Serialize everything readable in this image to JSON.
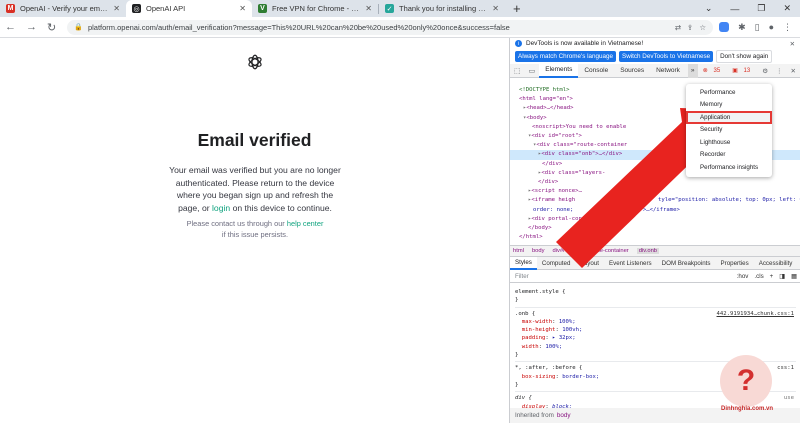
{
  "browser": {
    "tabs": [
      {
        "label": "OpenAI - Verify your email - kha",
        "favicon": "gmail-icon",
        "color": "#d93025",
        "active": false
      },
      {
        "label": "OpenAI API",
        "favicon": "openai-icon",
        "color": "#202123",
        "active": true
      },
      {
        "label": "Free VPN for Chrome - VPN Proxy",
        "favicon": "vpn-icon",
        "color": "#2e7d32",
        "active": false
      },
      {
        "label": "Thank you for installing VeePN",
        "favicon": "veepn-icon",
        "color": "#26a69a",
        "active": false
      }
    ],
    "new_tab": "+",
    "url": "platform.openai.com/auth/email_verification?message=This%20URL%20can%20be%20used%20only%20once&success=false"
  },
  "page": {
    "title": "Email verified",
    "desc_1": "Your email was verified but you are no longer authenticated. Please return to the device where you began sign up and refresh the page, or",
    "desc_link": "login",
    "desc_2": "on this device to continue.",
    "help_1": "Please contact us through our",
    "help_link": "help center",
    "help_2": "if this issue persists."
  },
  "devtools": {
    "info": "DevTools is now available in Vietnamese!",
    "btn_match": "Always match Chrome's language",
    "btn_switch": "Switch DevTools to Vietnamese",
    "btn_dismiss": "Don't show again",
    "tabs": [
      "Elements",
      "Console",
      "Sources",
      "Network"
    ],
    "more": "»",
    "errors": "35",
    "warnings": "13",
    "dom": [
      "<!DOCTYPE html>",
      "<html lang=\"en\">",
      "<head>…</head>",
      "<body>",
      "<noscript>You need to enable",
      "<div id=\"root\">",
      "<div class=\"route-container",
      "<div class=\"onb\">…</div>",
      "</div>",
      "<div class=\"layers-",
      "</div>",
      "<script nonce>…",
      "<iframe heigh",
      "order: none;",
      "<div portal-conta",
      "</body>",
      "</html>"
    ],
    "iframe_style": "tyle=\"position: absolute; top: 0px; left: 0px;",
    "iframe_end": "den;\">…</iframe>",
    "breadcrumbs": [
      "html",
      "body",
      "div#root",
      "div.route-container",
      "div.onb"
    ],
    "style_tabs": [
      "Styles",
      "Computed",
      "Layout",
      "Event Listeners",
      "DOM Breakpoints",
      "Properties",
      "Accessibility"
    ],
    "filter_placeholder": "Filter",
    "filter_hov": ":hov",
    "filter_cls": ".cls",
    "element_style": "element.style {",
    "onb_selector": ".onb {",
    "onb_source": "442.9191934…chunk.css:1",
    "onb_props": [
      {
        "name": "max-width",
        "value": "100%;"
      },
      {
        "name": "min-height",
        "value": "100vh;"
      },
      {
        "name": "padding",
        "value": "▸ 32px;"
      },
      {
        "name": "width",
        "value": "100%;"
      }
    ],
    "universal_selector": "*, :after, :before {",
    "universal_source": "main",
    "universal_source_2": "css:1",
    "universal_prop": {
      "name": "box-sizing",
      "value": "border-box;"
    },
    "div_selector": "div {",
    "div_source": "use",
    "div_prop": {
      "name": "display",
      "value": "block;"
    },
    "inherited_label": "Inherited from",
    "inherited_tag": "body",
    "close_brace": "}",
    "menu": [
      "Performance",
      "Memory",
      "Application",
      "Security",
      "Lighthouse",
      "Recorder",
      "Performance insights"
    ],
    "menu_highlight_index": 2
  },
  "watermark": {
    "glyph": "?",
    "text": "Dinhnghia.com.vn"
  },
  "colors": {
    "accent": "#1a73e8",
    "openai_green": "#10a37f",
    "annotation_red": "#e53935"
  }
}
